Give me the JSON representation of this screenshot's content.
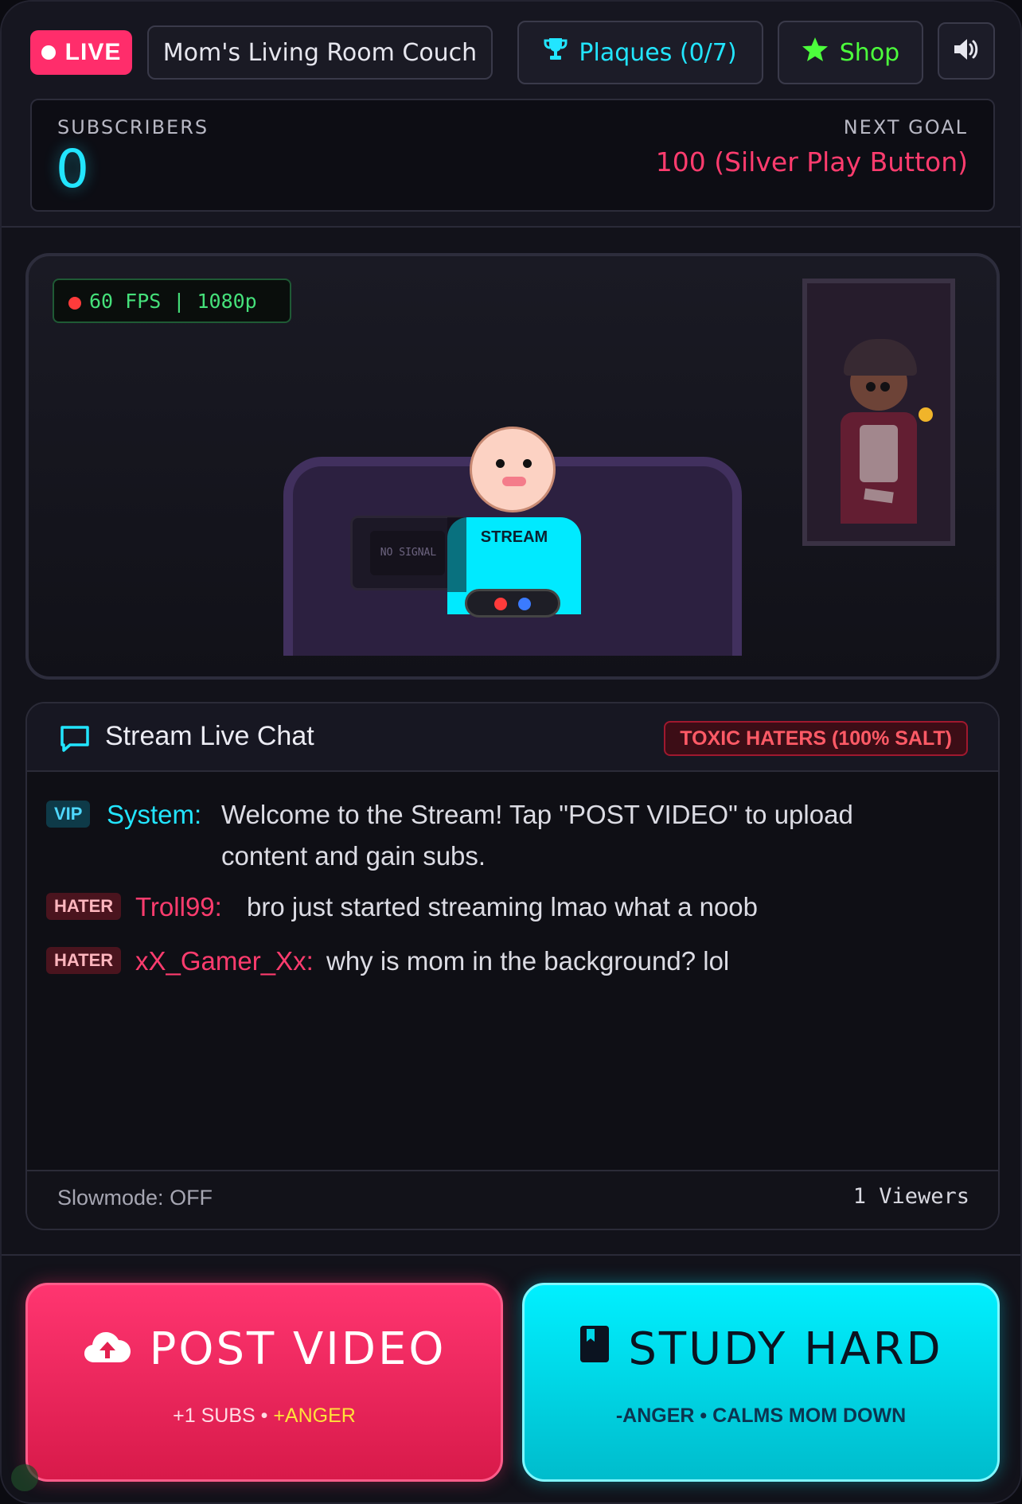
{
  "header": {
    "live_label": "LIVE",
    "location": "Mom's Living Room Couch",
    "plaques_label": "Plaques (0/7)",
    "shop_label": "Shop",
    "sound_icon": "volume-icon",
    "plaques_icon": "trophy-icon",
    "shop_icon": "star-icon"
  },
  "stats": {
    "subscribers_label": "SUBSCRIBERS",
    "subscribers_value": "0",
    "goal_label": "NEXT GOAL",
    "goal_value": "100 (Silver Play Button)"
  },
  "scene": {
    "fps_label": "60 FPS | 1080p",
    "monitor_text": "NO SIGNAL",
    "shirt_text": "STREAM"
  },
  "chat": {
    "title": "Stream Live Chat",
    "toxicity_badge": "TOXIC HATERS (100% SALT)",
    "messages": [
      {
        "tag": "VIP",
        "name": "System:",
        "text": "Welcome to the Stream! Tap \"POST VIDEO\" to upload content and gain subs."
      },
      {
        "tag": "HATER",
        "name": "Troll99:",
        "text": "bro just started streaming lmao what a noob"
      },
      {
        "tag": "HATER",
        "name": "xX_Gamer_Xx:",
        "text": "why is mom in the background? lol"
      }
    ],
    "slowmode": "Slowmode: OFF",
    "viewers": "1 Viewers"
  },
  "actions": {
    "post": {
      "label": "POST VIDEO",
      "sub_subs": "+1 SUBS",
      "sub_sep": " • ",
      "sub_anger": "+ANGER",
      "icon": "cloud-upload-icon"
    },
    "study": {
      "label": "STUDY HARD",
      "sub": "-ANGER • CALMS MOM DOWN",
      "icon": "book-icon"
    }
  },
  "colors": {
    "accent_pink": "#ff2d6b",
    "accent_cyan": "#00eaff",
    "accent_green": "#4cff3c",
    "background": "#12121a"
  }
}
